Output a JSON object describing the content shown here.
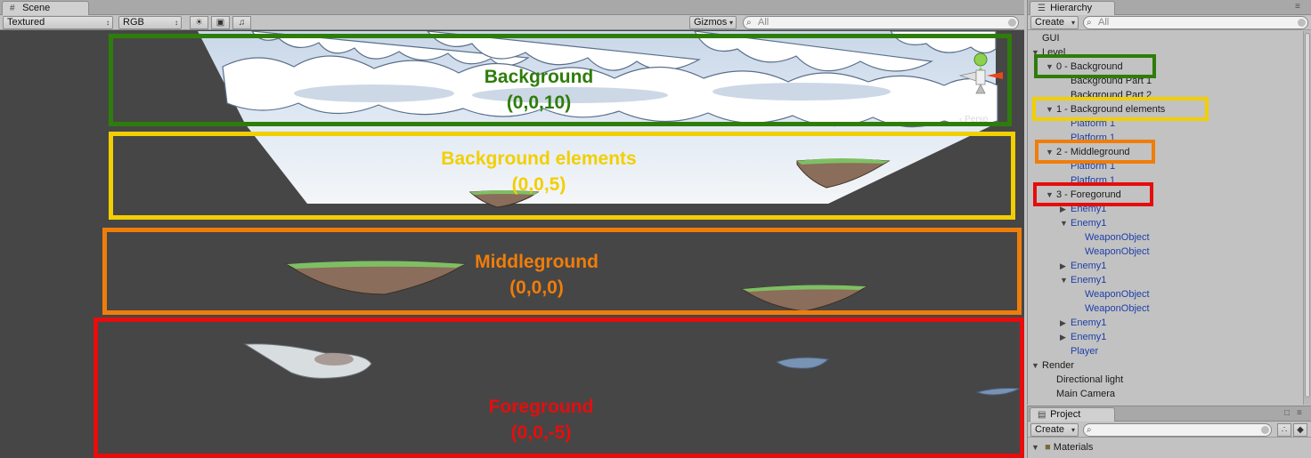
{
  "scene": {
    "tab_label": "Scene",
    "tab_icon": "grid-icon",
    "toolbar": {
      "render_mode": "Textured",
      "color_mode": "RGB",
      "gizmos_label": "Gizmos",
      "search_placeholder": "All"
    },
    "layers": [
      {
        "name": "Background",
        "coords": "(0,0,10)",
        "color": "#2e7d0b"
      },
      {
        "name": "Background elements",
        "coords": "(0,0,5)",
        "color": "#f2cf00"
      },
      {
        "name": "Middleground",
        "coords": "(0,0,0)",
        "color": "#f07d0a"
      },
      {
        "name": "Foreground",
        "coords": "(0,0,-5)",
        "color": "#e60d0d"
      }
    ],
    "persp_label": "Persp"
  },
  "hierarchy": {
    "tab_label": "Hierarchy",
    "create_label": "Create",
    "search_placeholder": "All",
    "items": [
      {
        "label": "GUI",
        "indent": 0,
        "arrow": "",
        "blue": false
      },
      {
        "label": "Level",
        "indent": 0,
        "arrow": "down",
        "blue": false
      },
      {
        "label": "0 - Background",
        "indent": 1,
        "arrow": "down",
        "blue": false
      },
      {
        "label": "Background Part 1",
        "indent": 2,
        "arrow": "",
        "blue": false
      },
      {
        "label": "Background Part 2",
        "indent": 2,
        "arrow": "",
        "blue": false
      },
      {
        "label": "1 - Background elements",
        "indent": 1,
        "arrow": "down",
        "blue": false
      },
      {
        "label": "Platform 1",
        "indent": 2,
        "arrow": "",
        "blue": true
      },
      {
        "label": "Platform 1",
        "indent": 2,
        "arrow": "",
        "blue": true
      },
      {
        "label": "2 - Middleground",
        "indent": 1,
        "arrow": "down",
        "blue": false
      },
      {
        "label": "Platform 1",
        "indent": 2,
        "arrow": "",
        "blue": true
      },
      {
        "label": "Platform 1",
        "indent": 2,
        "arrow": "",
        "blue": true
      },
      {
        "label": "3 - Foregorund",
        "indent": 1,
        "arrow": "down",
        "blue": false
      },
      {
        "label": "Enemy1",
        "indent": 2,
        "arrow": "right",
        "blue": true
      },
      {
        "label": "Enemy1",
        "indent": 2,
        "arrow": "down",
        "blue": true
      },
      {
        "label": "WeaponObject",
        "indent": 3,
        "arrow": "",
        "blue": true
      },
      {
        "label": "WeaponObject",
        "indent": 3,
        "arrow": "",
        "blue": true
      },
      {
        "label": "Enemy1",
        "indent": 2,
        "arrow": "right",
        "blue": true
      },
      {
        "label": "Enemy1",
        "indent": 2,
        "arrow": "down",
        "blue": true
      },
      {
        "label": "WeaponObject",
        "indent": 3,
        "arrow": "",
        "blue": true
      },
      {
        "label": "WeaponObject",
        "indent": 3,
        "arrow": "",
        "blue": true
      },
      {
        "label": "Enemy1",
        "indent": 2,
        "arrow": "right",
        "blue": true
      },
      {
        "label": "Enemy1",
        "indent": 2,
        "arrow": "right",
        "blue": true
      },
      {
        "label": "Player",
        "indent": 2,
        "arrow": "",
        "blue": true
      },
      {
        "label": "Render",
        "indent": 0,
        "arrow": "down",
        "blue": false
      },
      {
        "label": "Directional light",
        "indent": 1,
        "arrow": "",
        "blue": false
      },
      {
        "label": "Main Camera",
        "indent": 1,
        "arrow": "",
        "blue": false
      }
    ]
  },
  "project": {
    "tab_label": "Project",
    "create_label": "Create",
    "first_item": "Materials"
  }
}
